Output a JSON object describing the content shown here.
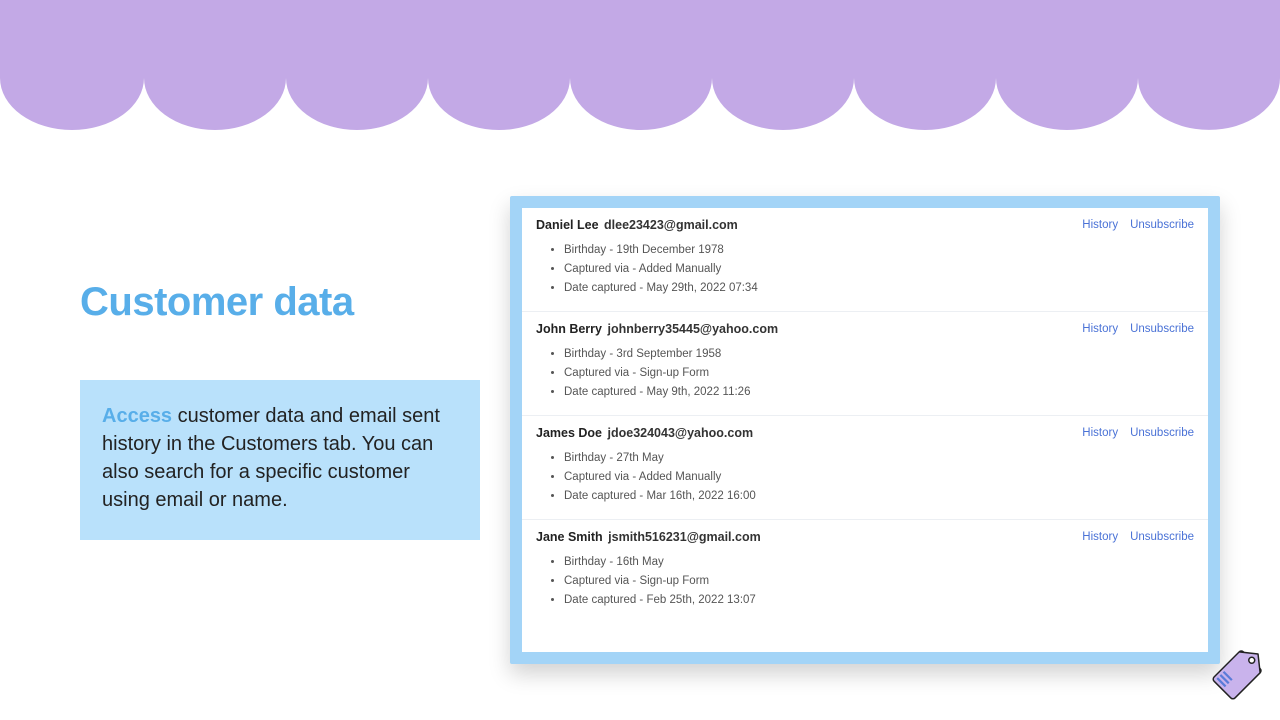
{
  "colors": {
    "lilac": "#c3a9e6",
    "blue_heading": "#58aee9",
    "blue_light": "#b9e1fb",
    "blue_panel": "#a3d4f7",
    "link": "#4a72d6"
  },
  "heading": "Customer data",
  "description": {
    "lead": "Access",
    "rest": " customer data and email sent history in the Customers tab. You can also search for a specific customer using email or name."
  },
  "labels": {
    "history": "History",
    "unsubscribe": "Unsubscribe",
    "birthday": "Birthday - ",
    "captured_via": "Captured via - ",
    "date_captured": "Date captured - "
  },
  "records": [
    {
      "name": "Daniel Lee",
      "email": "dlee23423@gmail.com",
      "birthday": " 19th December 1978",
      "captured_via": "Added Manually",
      "date_captured": "May 29th, 2022 07:34"
    },
    {
      "name": "John Berry",
      "email": "johnberry35445@yahoo.com",
      "birthday": "3rd September 1958",
      "captured_via": "Sign-up Form",
      "date_captured": "May 9th, 2022 11:26"
    },
    {
      "name": "James Doe",
      "email": "jdoe324043@yahoo.com",
      "birthday": "27th May",
      "captured_via": "Added Manually",
      "date_captured": "Mar 16th, 2022 16:00"
    },
    {
      "name": "Jane Smith",
      "email": "jsmith516231@gmail.com",
      "birthday": "16th May",
      "captured_via": "Sign-up Form",
      "date_captured": "Feb 25th, 2022 13:07"
    }
  ]
}
